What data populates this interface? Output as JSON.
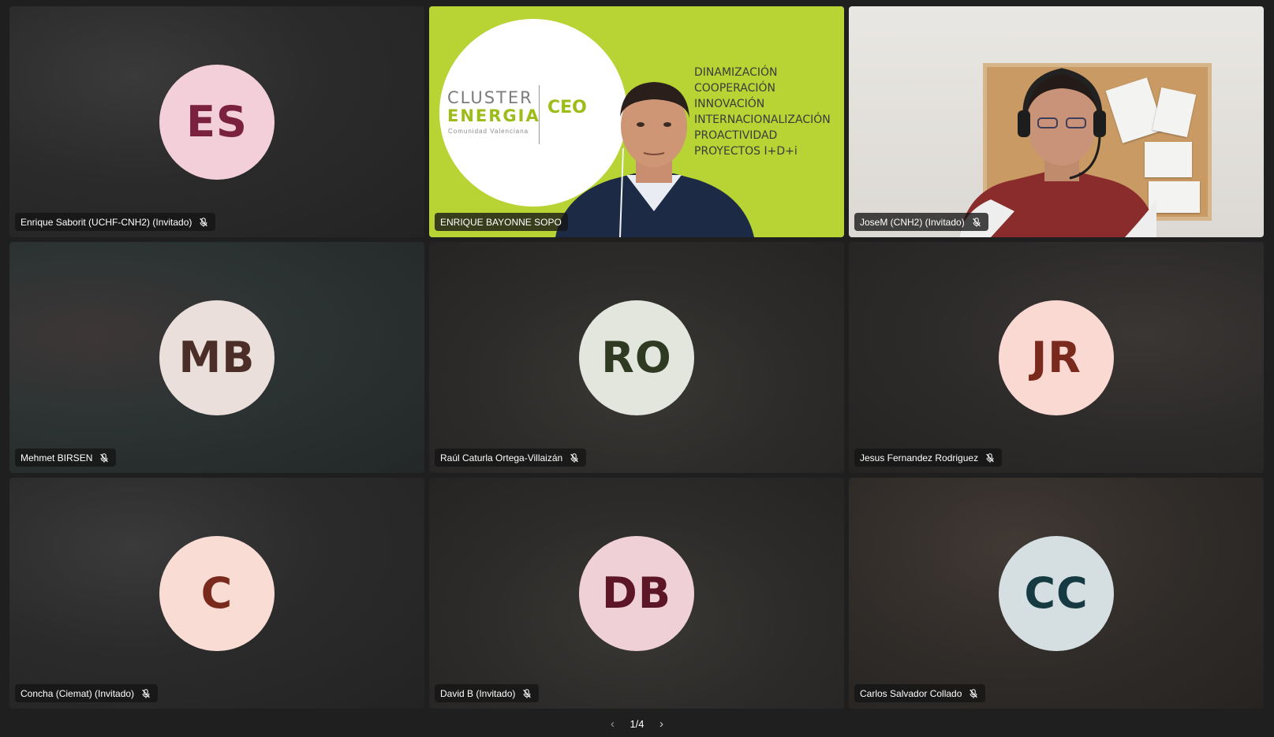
{
  "participants": [
    {
      "name": "Enrique Saborit (UCHF-CNH2) (Invitado)",
      "initials": "ES",
      "avatar_bg": "#f3cfd9",
      "avatar_fg": "#7a2140"
    },
    {
      "name": "ENRIQUE BAYONNE SOPO",
      "video": true,
      "active_speaker": true,
      "slide": {
        "logo_line1": "CLUSTER",
        "logo_line2": "ENERGIA",
        "logo_line3": "Comunidad Valenciana",
        "logo_ceo": "CEO",
        "items": [
          "DINAMIZACIÓN",
          "COOPERACIÓN",
          "INNOVACIÓN",
          "INTERNACIONALIZACIÓN",
          "PROACTIVIDAD",
          "PROYECTOS I+D+i"
        ]
      }
    },
    {
      "name": "JoseM (CNH2) (Invitado)",
      "video": true
    },
    {
      "name": "Mehmet BIRSEN",
      "initials": "MB",
      "avatar_bg": "#eadfdb",
      "avatar_fg": "#4a2e27"
    },
    {
      "name": "Raúl Caturla Ortega-Villaizán",
      "initials": "RO",
      "avatar_bg": "#e3e6dd",
      "avatar_fg": "#2f3a22"
    },
    {
      "name": "Jesus Fernandez Rodriguez",
      "initials": "JR",
      "avatar_bg": "#f9d9d1",
      "avatar_fg": "#7a2a1c"
    },
    {
      "name": "Concha (Ciemat) (Invitado)",
      "initials": "C",
      "avatar_bg": "#f9dcd4",
      "avatar_fg": "#7a2a1c"
    },
    {
      "name": "David B (Invitado)",
      "initials": "DB",
      "avatar_bg": "#efd0d6",
      "avatar_fg": "#5d1626"
    },
    {
      "name": "Carlos Salvador Collado",
      "initials": "CC",
      "avatar_bg": "#d5dfe2",
      "avatar_fg": "#153a42"
    }
  ],
  "pager": {
    "label": "1/4",
    "prev_icon": "chevron-left-icon",
    "next_icon": "chevron-right-icon"
  },
  "icons": {
    "muted": "mic-off-icon"
  }
}
